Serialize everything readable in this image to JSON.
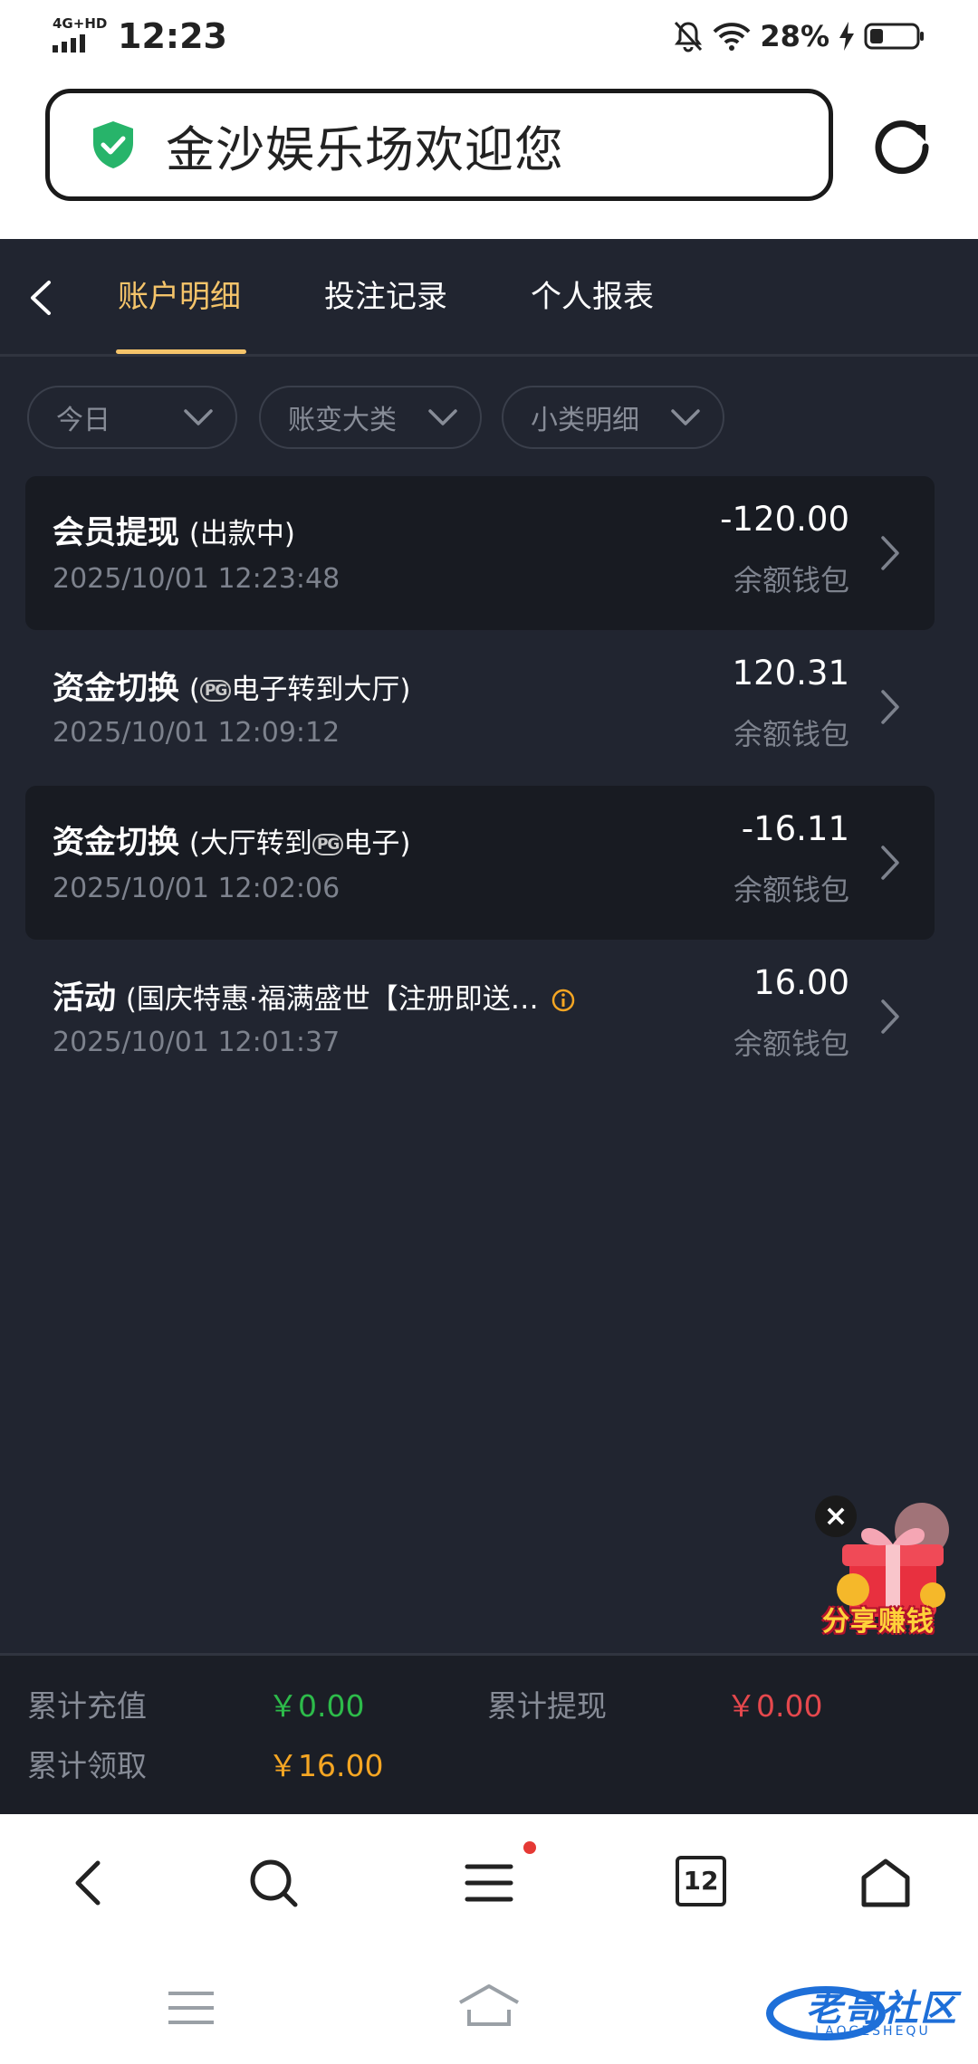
{
  "status_bar": {
    "network": "4G+HD",
    "time": "12:23",
    "battery": "28%"
  },
  "browser": {
    "page_title": "金沙娱乐场欢迎您"
  },
  "tabs": [
    {
      "label": "账户明细",
      "active": true
    },
    {
      "label": "投注记录",
      "active": false
    },
    {
      "label": "个人报表",
      "active": false
    }
  ],
  "filters": [
    {
      "label": "今日"
    },
    {
      "label": "账变大类"
    },
    {
      "label": "小类明细"
    }
  ],
  "records": [
    {
      "type": "会员提现",
      "detail": "(出款中)",
      "date": "2025/10/01 12:23:48",
      "amount": "-120.00",
      "wallet": "余额钱包"
    },
    {
      "type": "资金切换",
      "detail_pre": "(",
      "pg_logo": "PG",
      "detail_post": "电子转到大厅)",
      "date": "2025/10/01 12:09:12",
      "amount": "120.31",
      "wallet": "余额钱包"
    },
    {
      "type": "资金切换",
      "detail_pre": "(大厅转到",
      "pg_logo": "PG",
      "detail_post": "电子)",
      "date": "2025/10/01 12:02:06",
      "amount": "-16.11",
      "wallet": "余额钱包"
    },
    {
      "type": "活动",
      "detail": "(国庆特惠·福满盛世【注册即送…",
      "date": "2025/10/01 12:01:37",
      "amount": "16.00",
      "wallet": "余额钱包"
    }
  ],
  "promo": {
    "label": "分享赚钱"
  },
  "summary": {
    "recharge_label": "累计充值",
    "recharge_value": "￥0.00",
    "withdraw_label": "累计提现",
    "withdraw_value": "￥0.00",
    "claim_label": "累计领取",
    "claim_value": "￥16.00"
  },
  "toolbar": {
    "tab_count": "12"
  },
  "watermark": {
    "text": "老哥社区",
    "sub": "LAOGESHEQU"
  },
  "colors": {
    "accent_gold": "#f5c46a",
    "recharge_green": "#2dbb4a",
    "withdraw_red": "#e5484d",
    "claim_orange": "#f5a623",
    "app_bg": "#212530"
  },
  "icons": [
    "signal-icon",
    "mute-icon",
    "wifi-icon",
    "charging-icon",
    "battery-icon",
    "shield-check-icon",
    "reload-icon",
    "back-chevron-icon",
    "chevron-down-icon",
    "chevron-right-icon",
    "info-icon",
    "close-icon",
    "gift-icon",
    "search-icon",
    "menu-icon",
    "tabs-icon",
    "home-icon"
  ]
}
